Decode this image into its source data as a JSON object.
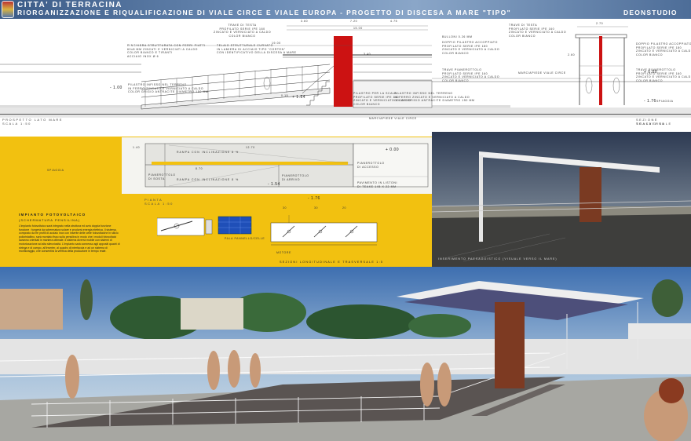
{
  "header": {
    "title": "CITTA' DI TERRACINA",
    "subtitle": "RIORGANIZZAZIONE E RIQUALIFICAZIONE DI VIALE CIRCE E VIALE EUROPA  -  PROGETTO DI DISCESA A MARE \"TIPO\"",
    "studio": "DEONSTUDIO"
  },
  "elevation": {
    "dims": {
      "d1": "3.60",
      "d2": "7.20",
      "d3": "4.75",
      "d4": "15.00",
      "d5": "19.00",
      "d6": "1.60",
      "d7": "3.60",
      "d8": "3.10",
      "d9": "2.70"
    },
    "levels": {
      "minus100": "- 1.00",
      "plus154": "+ 1.54",
      "plus000": "+ 0.00",
      "minus176": "- 1.76",
      "v340": "3.40",
      "v260": "2.60",
      "v015": "0.15",
      "v340b": "3.40"
    },
    "notes": {
      "trave_testa": "TRAVE DI TESTA\nPROFILATO SERIE IPE 160\nZINCATO E VERNICIATO A CALDO\nCOLOR BIANCO",
      "trave_testa_r": "TRAVE DI TESTA\nPROFILATO SERIE IPE 160\nZINCATO E VERNICIATO A CALDO\nCOLOR BIANCO",
      "ringhiera": "RINGHIERA STRUTTURATA CON FERRI PIATTI\n60x8 MM ZINCATI E VERNICIATI A CALDO\nCOLOR BIANCO E TIRANTI\nACCIAIO INOX Ø 6",
      "telaio": "TELAIO STRUTTURALE CURVATO\nIN LAMIERA DI ACCIAIO TIPO \"CORTEN\"\nCON IDENTIFICATIVO DELLA DISCESA A MARE",
      "bullone": "BULLONI 0.26 MM",
      "doppio": "DOPPIO PILASTRO ACCOPPIATO\nPROFILATO SERIE IPE 180\nZINCATO E VERNICIATO A CALDO\nCOLOR BIANCO",
      "doppio_r": "DOPPIO PILASTRO ACCOPPIATO\nPROFILATO SERIE IPE 180\nZINCATO E VERNICIATO A CALDO\nCOLOR BIANCO",
      "trave_piano": "TRAVE PIANEROTTOLO\nPROFILATO SERIE IPE 160\nZINCATO E VERNICIATO A CALDO\nCOLOR BIANCO",
      "trave_piano_r": "TRAVE PIANEROTTOLO\nPROFILATO SERIE IPE 160\nZINCATO E VERNICIATO A CALDO\nCOLOR BIANCO",
      "pilastro_scala": "PILASTRO PER LA SCALA\nPROFILATO SERIE IPE 160\nZINCATO E VERNICIATO A CALDO\nCOLOR BIANCO",
      "pilastro_infisso": "PILASTRO INFISSO NEL TERRENO\nIN FERRO ZINCATO E VERNICIATO A CALDO\nCOLOR GRIGIO ANTRACITE DIAMETRO 150 MM",
      "pilastro_infisso_l": "PILASTRO INFISSO NEL TERRENO\nIN FERRO ZINCATO E VERNICIATO A CALDO\nCOLOR GRIGIO ANTRACITE DIAMETRO 150 MM",
      "marciapiede": "MARCIAPIEDE VIALE CIRCE",
      "marciapiede_top": "MARCIAPIEDE VIALE CIRCE",
      "spiaggia": "SPIAGGIA"
    },
    "prospetto": "PROSPETTO LATO MARE",
    "prospetto_scale": "SCALA 1:50",
    "sezione": "SEZIONE TRASVERSALE",
    "sezione_scale": "SCALA 1:50"
  },
  "plan": {
    "rampa1": "RAMPA CON INCLINAZIONE 8 %",
    "rampa2": "RAMPA CON INCLINAZIONE 8 %",
    "pianerottolo1": "PIANEROTTOLO\nDI SOSTA",
    "pianerottolo2": "PIANEROTTOLO\nDI ARRIVO",
    "pianerottolo3": "PIANEROTTOLO\nDI ACCESSO",
    "pavimento": "PAVIMENTO IN LISTONI\nDI TEAKE 145 X 22 MM",
    "spiaggia": "SPIAGGIA",
    "pianta": "PIANTA",
    "pianta_scale": "SCALA 1:50",
    "dims": {
      "a": "1.40",
      "b": "12.70",
      "c": "1.40",
      "d": "8.70",
      "e": "1.80",
      "f": "1.30",
      "g": "1.80"
    },
    "levels": {
      "p000": "+ 0.00",
      "m154": "- 1.54",
      "m176": "- 1.76",
      "m100": "- 1.00"
    }
  },
  "pv": {
    "title": "IMPIANTO FOTOVOLTAICO",
    "subtitle": "(SCHERMATURA PENSILINA)",
    "body": "L'impianto fotovoltaico sarà integrato nella struttura ed avrà doppia funzione funzione : fungerà da schermatura solare e produrrà energia elettrica. Il sistema, composto da tre profili di acciaio inox con inserite delle celle fotovoltaiche in silicio policristallino, sarà montato fisso sulla pensilina in modo che i moduli fotovoltaici saranno orientati in maniera ottimale. Il sistema diverrà mobile con sistemi di motorizzazione ad alta silenziosità. L'impianto sarà connesso agli appositi quadri di stringa e di campo, all'inverter, al quadro di interfaccia e ad un sistema di monitoraggio, che consentirà la verifica della produzione in tempo reale.",
    "pala": "PALA PANNELLO/CELLE",
    "motore": "MOTORE",
    "sezione": "SEZIONI LONGITUDINALE E TRASVERSALE 1:5",
    "dims": {
      "d1": "30",
      "d2": "30",
      "d3": "20"
    }
  },
  "render": {
    "caption": "INSERIMENTO PAESAGGISTICO (VISUALE VERSO IL MARE)"
  },
  "colors": {
    "yellow": "#f2c110",
    "red": "#cc1212",
    "blue_header": "#4d6d98"
  }
}
